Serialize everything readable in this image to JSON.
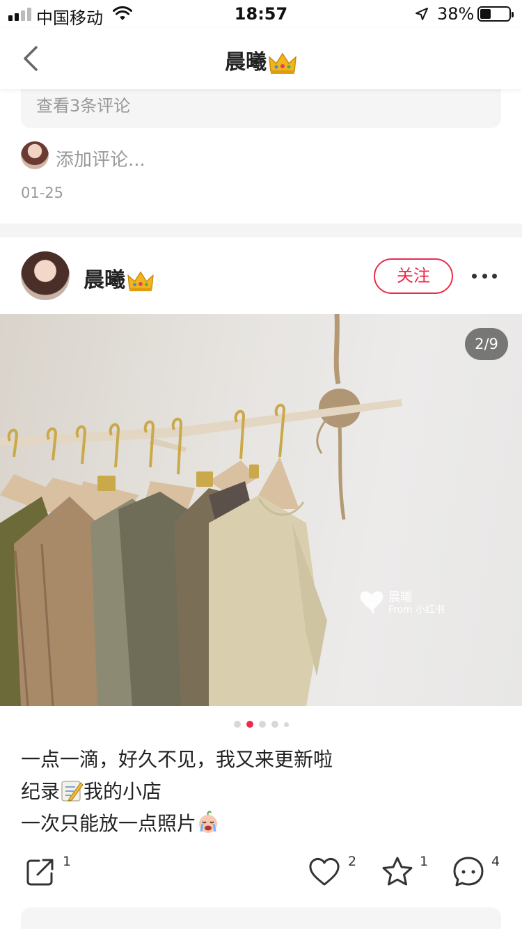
{
  "status_bar": {
    "carrier": "中国移动",
    "time": "18:57",
    "battery": "38%",
    "battery_level": 0.38
  },
  "nav": {
    "title": "晨曦"
  },
  "prev_post": {
    "view_comments": "查看3条评论",
    "add_comment_placeholder": "添加评论...",
    "date": "01-25"
  },
  "post": {
    "author": "晨曦",
    "follow_label": "关注",
    "page_indicator": "2/9",
    "watermark_name": "晨曦",
    "watermark_from": "From 小红书",
    "caption": {
      "line1": "一点一滴，好久不见，我又来更新啦",
      "line2a": "纪录",
      "line2b": "我的小店",
      "line3": "一次只能放一点照片"
    },
    "carousel": {
      "total_dots": 5,
      "active_index": 1
    },
    "actions": {
      "share_count": "1",
      "like_count": "2",
      "collect_count": "1",
      "comment_count": "4"
    }
  },
  "colors": {
    "accent": "#ee2a4b",
    "muted_text": "#999999",
    "card_bg": "#f5f5f5"
  },
  "icons": [
    "back-icon",
    "crown-icon",
    "more-icon",
    "share-icon",
    "heart-icon",
    "star-icon",
    "comment-icon",
    "memo-emoji",
    "crying-baby-emoji"
  ]
}
